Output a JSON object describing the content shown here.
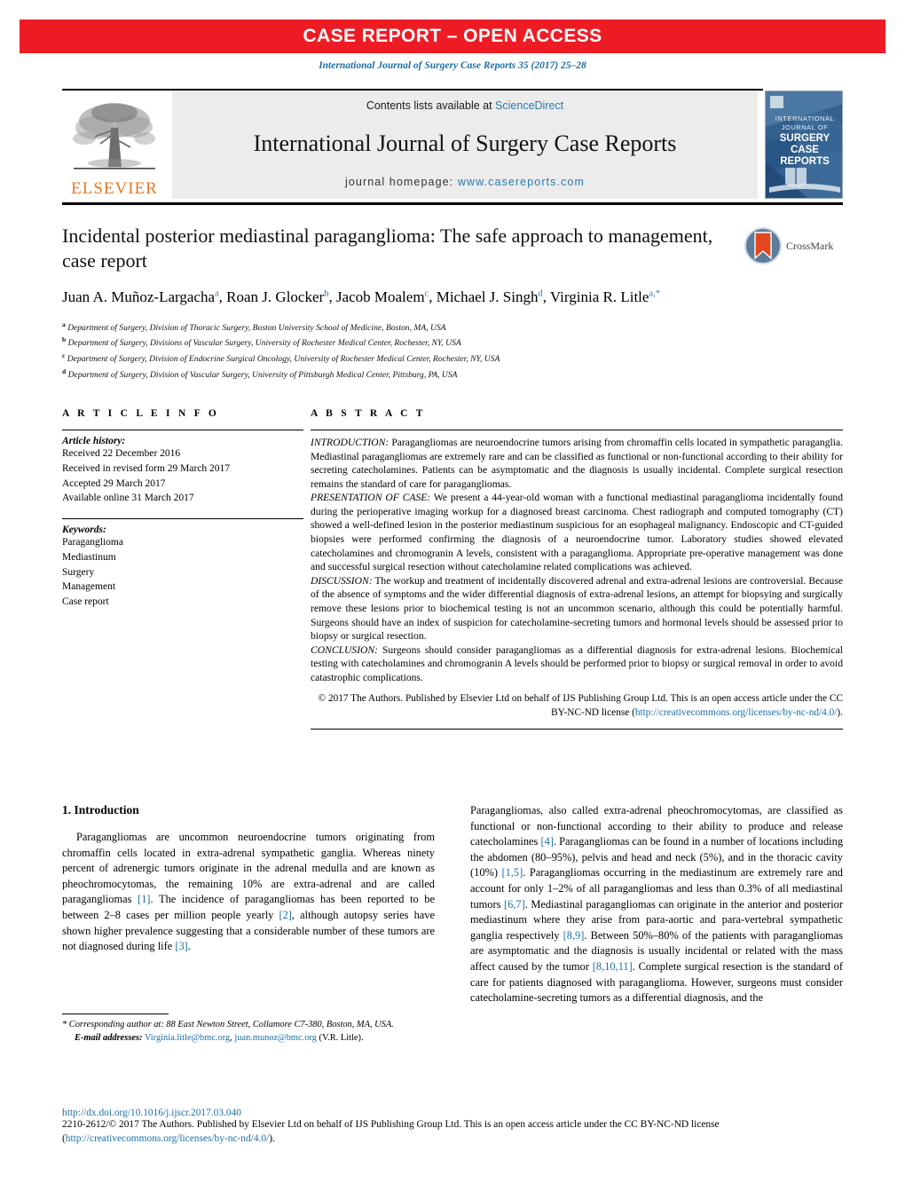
{
  "banner": {
    "label": "CASE REPORT – OPEN ACCESS",
    "color": "#ed1c24"
  },
  "citation": "International Journal of Surgery Case Reports 35 (2017) 25–28",
  "masthead": {
    "contents_prefix": "Contents lists available at ",
    "contents_link": "ScienceDirect",
    "journal_title": "International Journal of Surgery Case Reports",
    "homepage_prefix": "journal homepage: ",
    "homepage_url": "www.casereports.com",
    "publisher": "ELSEVIER",
    "cover": {
      "line1": "INTERNATIONAL",
      "line2": "JOURNAL OF",
      "line3": "SURGERY",
      "line4": "CASE",
      "line5": "REPORTS"
    }
  },
  "article": {
    "title": "Incidental posterior mediastinal paraganglioma: The safe approach to management, case report",
    "crossmark_label": "CrossMark",
    "authors": [
      {
        "name": "Juan A. Muñoz-Largacha",
        "marks": "a",
        "sep": ", "
      },
      {
        "name": "Roan J. Glocker",
        "marks": "b",
        "sep": ", "
      },
      {
        "name": "Jacob Moalem",
        "marks": "c",
        "sep": ", "
      },
      {
        "name": "Michael J. Singh",
        "marks": "d",
        "sep": ", "
      },
      {
        "name": "Virginia R. Litle",
        "marks": "a,*",
        "sep": ""
      }
    ],
    "affiliations": [
      {
        "mark": "a",
        "text": "Department of Surgery, Division of Thoracic Surgery, Boston University School of Medicine, Boston, MA, USA"
      },
      {
        "mark": "b",
        "text": "Department of Surgery, Divisions of Vascular Surgery, University of Rochester Medical Center, Rochester, NY, USA"
      },
      {
        "mark": "c",
        "text": "Department of Surgery, Division of Endocrine Surgical Oncology, University of Rochester Medical Center, Rochester, NY, USA"
      },
      {
        "mark": "d",
        "text": "Department of Surgery, Division of Vascular Surgery, University of Pittsburgh Medical Center, Pittsburg, PA, USA"
      }
    ]
  },
  "article_info": {
    "heading": "A R T I C L E   I N F O",
    "history_label": "Article history:",
    "history": [
      "Received 22 December 2016",
      "Received in revised form 29 March 2017",
      "Accepted 29 March 2017",
      "Available online 31 March 2017"
    ],
    "keywords_label": "Keywords:",
    "keywords": [
      "Paraganglioma",
      "Mediastinum",
      "Surgery",
      "Management",
      "Case report"
    ]
  },
  "abstract": {
    "heading": "A B S T R A C T",
    "sections": [
      {
        "label": "INTRODUCTION:",
        "text": " Paragangliomas are neuroendocrine tumors arising from chromaffin cells located in sympathetic paraganglia. Mediastinal paragangliomas are extremely rare and can be classified as functional or non-functional according to their ability for secreting catecholamines. Patients can be asymptomatic and the diagnosis is usually incidental. Complete surgical resection remains the standard of care for paragangliomas."
      },
      {
        "label": "PRESENTATION OF CASE:",
        "text": " We present a 44-year-old woman with a functional mediastinal paraganglioma incidentally found during the perioperative imaging workup for a diagnosed breast carcinoma. Chest radiograph and computed tomography (CT) showed a well-defined lesion in the posterior mediastinum suspicious for an esophageal malignancy. Endoscopic and CT-guided biopsies were performed confirming the diagnosis of a neuroendocrine tumor. Laboratory studies showed elevated catecholamines and chromogranin A levels, consistent with a paraganglioma. Appropriate pre-operative management was done and successful surgical resection without catecholamine related complications was achieved."
      },
      {
        "label": "DISCUSSION:",
        "text": " The workup and treatment of incidentally discovered adrenal and extra-adrenal lesions are controversial. Because of the absence of symptoms and the wider differential diagnosis of extra-adrenal lesions, an attempt for biopsying and surgically remove these lesions prior to biochemical testing is not an uncommon scenario, although this could be potentially harmful. Surgeons should have an index of suspicion for catecholamine-secreting tumors and hormonal levels should be assessed prior to biopsy or surgical resection."
      },
      {
        "label": "CONCLUSION:",
        "text": " Surgeons should consider paragangliomas as a differential diagnosis for extra-adrenal lesions. Biochemical testing with catecholamines and chromogranin A levels should be performed prior to biopsy or surgical removal in order to avoid catastrophic complications."
      }
    ],
    "copyright_pre": "© 2017 The Authors. Published by Elsevier Ltd on behalf of IJS Publishing Group Ltd. This is an open access article under the CC BY-NC-ND license (",
    "copyright_link": "http://creativecommons.org/licenses/by-nc-nd/4.0/",
    "copyright_post": ")."
  },
  "body": {
    "section_heading": "1.  Introduction",
    "left_paragraph_pre": "Paragangliomas are uncommon neuroendocrine tumors originating from chromaffin cells located in extra-adrenal sympathetic ganglia. Whereas ninety percent of adrenergic tumors originate in the adrenal medulla and are known as pheochromocytomas, the remaining 10% are extra-adrenal and are called paragangliomas ",
    "left_segments": [
      {
        "type": "ref",
        "text": "[1]"
      },
      {
        "type": "txt",
        "text": ". The incidence of paragangliomas has been reported to be between 2–8 cases per million people yearly "
      },
      {
        "type": "ref",
        "text": "[2]"
      },
      {
        "type": "txt",
        "text": ", although autopsy series have shown higher prevalence suggesting that a considerable number of these tumors are not diagnosed during life "
      },
      {
        "type": "ref",
        "text": "[3]"
      },
      {
        "type": "txt",
        "text": "."
      }
    ],
    "right_segments": [
      {
        "type": "txt",
        "text": "Paragangliomas, also called extra-adrenal pheochromocytomas, are classified as functional or non-functional according to their ability to produce and release catecholamines "
      },
      {
        "type": "ref",
        "text": "[4]"
      },
      {
        "type": "txt",
        "text": ". Paragangliomas can be found in a number of locations including the abdomen (80–95%), pelvis and head and neck (5%), and in the thoracic cavity (10%) "
      },
      {
        "type": "ref",
        "text": "[1,5]"
      },
      {
        "type": "txt",
        "text": ". Paragangliomas occurring in the mediastinum are extremely rare and account for only 1–2% of all paragangliomas and less than 0.3% of all mediastinal tumors "
      },
      {
        "type": "ref",
        "text": "[6,7]"
      },
      {
        "type": "txt",
        "text": ". Mediastinal paragangliomas can originate in the anterior and posterior mediastinum where they arise from para-aortic and para-vertebral sympathetic ganglia respectively "
      },
      {
        "type": "ref",
        "text": "[8,9]"
      },
      {
        "type": "txt",
        "text": ". Between 50%–80% of the patients with paragangliomas are asymptomatic and the diagnosis is usually incidental or related with the mass affect caused by the tumor "
      },
      {
        "type": "ref",
        "text": "[8,10,11]"
      },
      {
        "type": "txt",
        "text": ". Complete surgical resection is the standard of care for patients diagnosed with paraganglioma. However, surgeons must consider catecholamine-secreting tumors as a differential diagnosis, and the"
      }
    ]
  },
  "footnotes": {
    "corresponding": "* Corresponding author at: 88 East Newton Street, Collamore C7-380, Boston, MA, USA.",
    "email_label": "E-mail addresses:",
    "email_1": "Virginia.litle@bmc.org",
    "email_2": "juan.munoz@bmc.org",
    "email_attrib": "(V.R. Litle)."
  },
  "page_footer": {
    "doi": "http://dx.doi.org/10.1016/j.ijscr.2017.03.040",
    "copyright_pre": "2210-2612/© 2017 The Authors. Published by Elsevier Ltd on behalf of IJS Publishing Group Ltd. This is an open access article under the CC BY-NC-ND license (",
    "copyright_link": "http://creativecommons.org/licenses/by-nc-nd/4.0/",
    "copyright_post": ")."
  }
}
